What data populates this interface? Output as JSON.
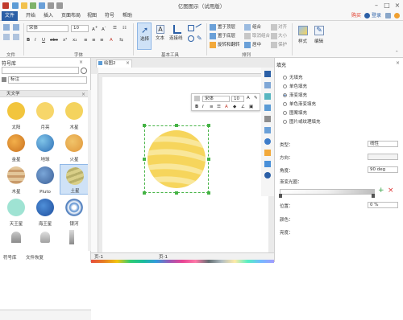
{
  "window": {
    "title": "亿图图示（试用版）"
  },
  "menubar": {
    "items": [
      "文件",
      "开始",
      "插入",
      "页面布局",
      "视图",
      "符号",
      "帮助"
    ],
    "buy_label": "购买",
    "login_label": "登录"
  },
  "ribbon": {
    "font_name": "宋体",
    "font_size": "10",
    "groups": {
      "file": "文件",
      "font": "字体",
      "basic_tools": "基本工具",
      "arrange": "排列"
    },
    "tools": {
      "select": "选择",
      "text": "文本",
      "connector": "连接线",
      "style": "样式",
      "edit": "编辑"
    },
    "arrange_buttons": [
      "置于顶层",
      "组合",
      "对齐",
      "置于底层",
      "取消组合",
      "大小",
      "旋转和翻转",
      "居中",
      "保护"
    ]
  },
  "left_panel": {
    "title": "符号库",
    "search_placeholder": "",
    "label_field": "标注",
    "library_name": "天文学",
    "symbols": [
      "太阳",
      "月亮",
      "木星",
      "金星",
      "地球",
      "火星",
      "木星",
      "Pluto",
      "土星",
      "天王星",
      "海王星",
      "银河",
      "",
      "",
      ""
    ],
    "bottom_tabs": [
      "符号库",
      "文件恢复"
    ]
  },
  "canvas": {
    "tab_label": "绘图2",
    "page_tab": "页-1",
    "page_tab2": "页-1",
    "float_toolbar": {
      "font": "宋体",
      "size": "10"
    }
  },
  "right_panel": {
    "title": "填充",
    "fill_options": [
      "无填充",
      "单色填充",
      "渐变填充",
      "单色渐变填充",
      "图案填充",
      "图片或纹理填充"
    ],
    "selected_fill": 2,
    "type_label": "类型：",
    "type_value": "线性",
    "direction_label": "方向：",
    "angle_label": "角度：",
    "angle_value": "90 deg",
    "gradient_label": "渐变光圈：",
    "position_label": "位置：",
    "position_value": "0 %",
    "color_label": "颜色：",
    "brightness_label": "亮度："
  },
  "colors": {
    "accent": "#2b5fa6",
    "buy": "#e0301e",
    "planet_base": "#f6d55c",
    "planet_stripe": "#f9e79b"
  }
}
